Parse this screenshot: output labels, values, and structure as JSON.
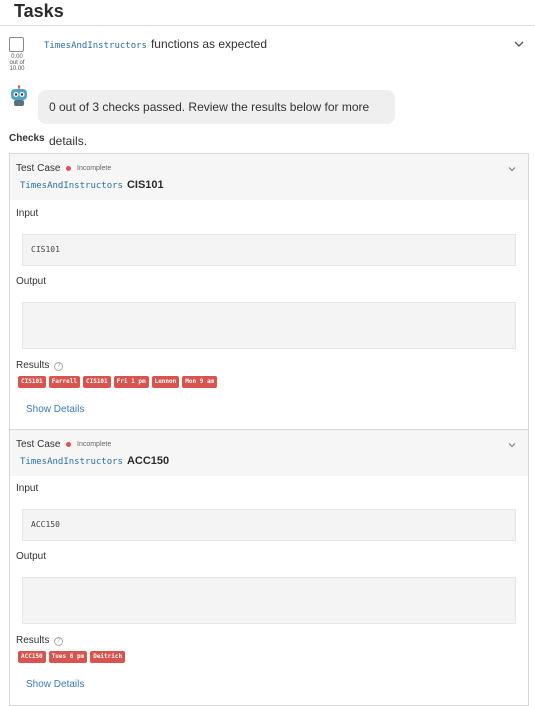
{
  "header": {
    "title": "Tasks"
  },
  "task": {
    "function_name": "TimesAndInstructors",
    "title_suffix": "functions as expected",
    "score": [
      "0.00",
      "out of",
      "10.00"
    ],
    "summary": "0 out of 3 checks passed. Review the results below for more details."
  },
  "checks": {
    "label": "Checks",
    "cases": [
      {
        "type_label": "Test Case",
        "status": "Incomplete",
        "function_name": "TimesAndInstructors",
        "name": "CIS101",
        "input_label": "Input",
        "input_value": "CIS101",
        "output_label": "Output",
        "output_value": "",
        "results_label": "Results",
        "results": [
          "CIS101",
          "Farrell",
          "CIS101",
          "Fri 1 pm",
          "Lennon",
          "Mon 9 am"
        ],
        "details_link": "Show Details"
      },
      {
        "type_label": "Test Case",
        "status": "Incomplete",
        "function_name": "TimesAndInstructors",
        "name": "ACC150",
        "input_label": "Input",
        "input_value": "ACC150",
        "output_label": "Output",
        "output_value": "",
        "results_label": "Results",
        "results": [
          "ACC150",
          "Tues 6 pm",
          "Deitrich"
        ],
        "details_link": "Show Details"
      }
    ]
  },
  "colors": {
    "fail": "#d9534f",
    "status_dot": "#e05252",
    "link": "#3a7bbf",
    "code": "#2a6fa8"
  },
  "icons": {
    "chevron": "chevron-down-icon",
    "help": "help-icon",
    "robot": "robot-icon"
  }
}
